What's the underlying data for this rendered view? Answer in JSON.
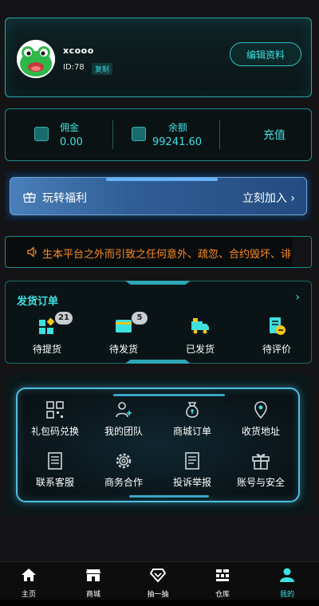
{
  "profile": {
    "username": "xcooo",
    "id_text": "ID:78",
    "copy_label": "复制",
    "edit_label": "编辑资料"
  },
  "balance": {
    "commission_label": "佣金",
    "commission_value": "0.00",
    "balance_label": "余额",
    "balance_value": "99241.60",
    "recharge_label": "充值"
  },
  "welfare": {
    "title": "玩转福利",
    "join_label": "立刻加入"
  },
  "notice": {
    "text": "生本平台之外而引致之任何意外、疏忽、合约毁坏、诽"
  },
  "orders": {
    "title": "发货订单",
    "items": [
      {
        "label": "待提货",
        "badge": "21",
        "icon": "grid-icon"
      },
      {
        "label": "待发货",
        "badge": "5",
        "icon": "card-icon"
      },
      {
        "label": "已发货",
        "badge": "",
        "icon": "truck-icon"
      },
      {
        "label": "待评价",
        "badge": "",
        "icon": "review-icon"
      }
    ]
  },
  "services": {
    "items": [
      {
        "label": "礼包码兑换",
        "icon": "qrcode-icon"
      },
      {
        "label": "我的团队",
        "icon": "team-icon"
      },
      {
        "label": "商城订单",
        "icon": "moneybag-icon"
      },
      {
        "label": "收货地址",
        "icon": "location-icon"
      },
      {
        "label": "联系客服",
        "icon": "document-icon"
      },
      {
        "label": "商务合作",
        "icon": "gear-icon"
      },
      {
        "label": "投诉举报",
        "icon": "report-icon"
      },
      {
        "label": "账号与安全",
        "icon": "gift-icon"
      }
    ]
  },
  "tabbar": {
    "items": [
      {
        "label": "主页",
        "icon": "home-icon"
      },
      {
        "label": "商城",
        "icon": "shop-icon"
      },
      {
        "label": "抽一抽",
        "icon": "diamond-icon"
      },
      {
        "label": "仓库",
        "icon": "warehouse-icon"
      },
      {
        "label": "我的",
        "icon": "user-icon"
      }
    ],
    "active_index": 4
  },
  "colors": {
    "accent": "#3ee0e0",
    "notice": "#ff8a20",
    "banner": "#305e96",
    "background": "#141416"
  }
}
